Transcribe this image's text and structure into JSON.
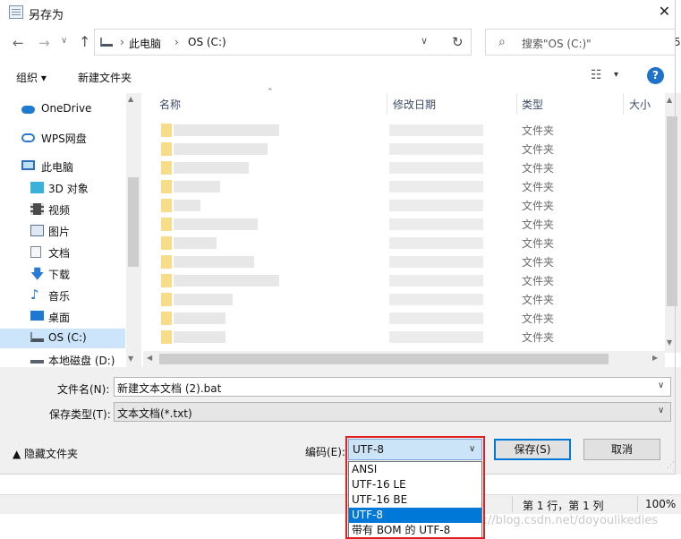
{
  "window": {
    "title": "另存为",
    "close_glyph": "✕"
  },
  "nav_buttons": {
    "back": "←",
    "forward": "→",
    "recent": "∨",
    "up": "↑"
  },
  "address": {
    "breadcrumbs": [
      "此电脑",
      "OS (C:)"
    ],
    "separator": "›",
    "dropdown_glyph": "∨",
    "refresh_glyph": "↻"
  },
  "search": {
    "placeholder": "搜索\"OS (C:)\"",
    "icon": "search-icon"
  },
  "toolbar": {
    "organize": "组织 ▾",
    "new_folder": "新建文件夹",
    "view_glyph": "☷",
    "view_dd": "▾",
    "help": "?"
  },
  "nav_pane": {
    "items": [
      {
        "label": "OneDrive",
        "icon": "onedrive-icon",
        "color": "#1f7ad1"
      },
      {
        "label": "WPS网盘",
        "icon": "wps-cloud-icon",
        "color": "#2e79c9"
      },
      {
        "label": "此电脑",
        "icon": "computer-icon",
        "color": "#2f6fb5"
      },
      {
        "label": "3D 对象",
        "icon": "3d-objects-icon",
        "color": "#3ab1d8"
      },
      {
        "label": "视频",
        "icon": "video-icon",
        "color": "#4a4a4a"
      },
      {
        "label": "图片",
        "icon": "pictures-icon",
        "color": "#5b6f8c"
      },
      {
        "label": "文档",
        "icon": "documents-icon",
        "color": "#7b8595"
      },
      {
        "label": "下载",
        "icon": "downloads-icon",
        "color": "#2a7bd6"
      },
      {
        "label": "音乐",
        "icon": "music-icon",
        "color": "#1e73d2"
      },
      {
        "label": "桌面",
        "icon": "desktop-icon",
        "color": "#1f78d0"
      },
      {
        "label": "OS (C:)",
        "icon": "drive-c-icon",
        "color": "#4a5561",
        "selected": true
      },
      {
        "label": "本地磁盘 (D:)",
        "icon": "drive-d-icon",
        "color": "#5a6270"
      }
    ]
  },
  "file_list": {
    "columns": [
      "名称",
      "修改日期",
      "类型",
      "大小"
    ],
    "rows": [
      {
        "type": "文件夹"
      },
      {
        "type": "文件夹"
      },
      {
        "type": "文件夹"
      },
      {
        "type": "文件夹"
      },
      {
        "type": "文件夹"
      },
      {
        "type": "文件夹"
      },
      {
        "type": "文件夹"
      },
      {
        "type": "文件夹"
      },
      {
        "type": "文件夹"
      },
      {
        "type": "文件夹"
      },
      {
        "type": "文件夹"
      },
      {
        "type": "文件夹"
      }
    ]
  },
  "form": {
    "filename_label": "文件名(N):",
    "filename_value": "新建文本文档 (2).bat",
    "filetype_label": "保存类型(T):",
    "filetype_value": "文本文档(*.txt)",
    "hide_folders": "▲ 隐藏文件夹",
    "encoding_label": "编码(E):",
    "encoding_value": "UTF-8",
    "save": "保存(S)",
    "cancel": "取消",
    "dd_glyph": "∨"
  },
  "encoding_options": [
    {
      "label": "ANSI"
    },
    {
      "label": "UTF-16 LE"
    },
    {
      "label": "UTF-16 BE"
    },
    {
      "label": "UTF-8",
      "selected": true
    },
    {
      "label": "带有 BOM 的 UTF-8"
    }
  ],
  "status_bar": {
    "position": "第 1 行，第 1 列",
    "zoom": "100%"
  },
  "background": {
    "right_digit": "5",
    "watermark": "https://blog.csdn.net/doyoulikedies"
  },
  "colors": {
    "accent": "#0078d7",
    "highlight_box": "#e02020",
    "selection": "#cce5fb"
  }
}
